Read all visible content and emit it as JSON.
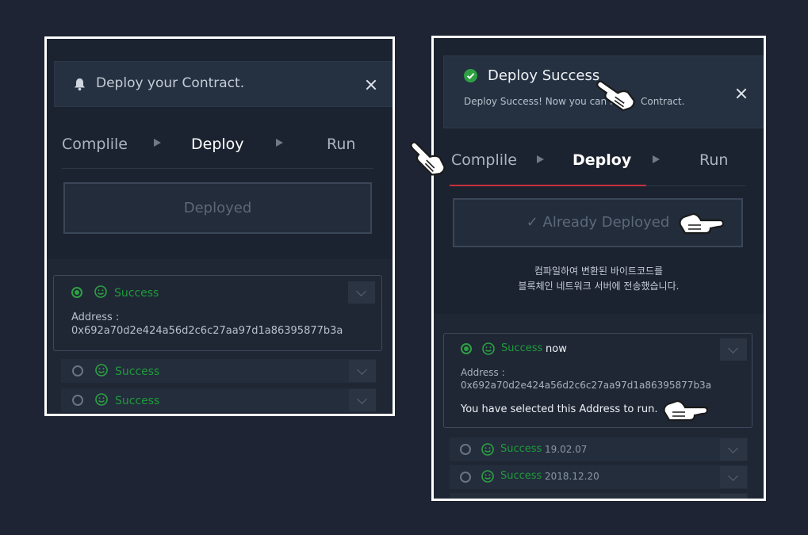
{
  "left": {
    "toast_message": "Deploy your Contract.",
    "steps": [
      "Complile",
      "Deploy",
      "Run"
    ],
    "button_label": "Deployed",
    "results": [
      {
        "status": "Success",
        "address_label": "Address :",
        "address": "0x692a70d2e424a56d2c6c27aa97d1a86395877b3a"
      },
      {
        "status": "Success"
      },
      {
        "status": "Success"
      }
    ]
  },
  "right": {
    "toast_title": "Deploy Success",
    "toast_message_a": "Deploy Success! Now you can Ru",
    "toast_message_b": "Contract.",
    "steps": [
      "Complile",
      "Deploy",
      "Run"
    ],
    "button_label": "✓ Already Deployed",
    "info_line1": "컴파일하여 변환된 바이트코드를",
    "info_line2": "블록체인 네트워크 서버에 전송했습니다.",
    "results": [
      {
        "status": "Success",
        "time": "now",
        "address_label": "Address :",
        "address": "0x692a70d2e424a56d2c6c27aa97d1a86395877b3a",
        "note": "You have selected this Address to run."
      },
      {
        "status": "Success",
        "time": "19.02.07"
      },
      {
        "status": "Success",
        "time": "2018.12.20"
      }
    ]
  },
  "colors": {
    "background": "#1e2433",
    "panel": "#1f2735",
    "success_green": "#2ea043",
    "accent_red": "#c8303c"
  },
  "icons": [
    "bell-icon",
    "close-icon",
    "check-circle-icon",
    "smile-icon",
    "chevron-down-icon",
    "hand-pointer-icon"
  ]
}
